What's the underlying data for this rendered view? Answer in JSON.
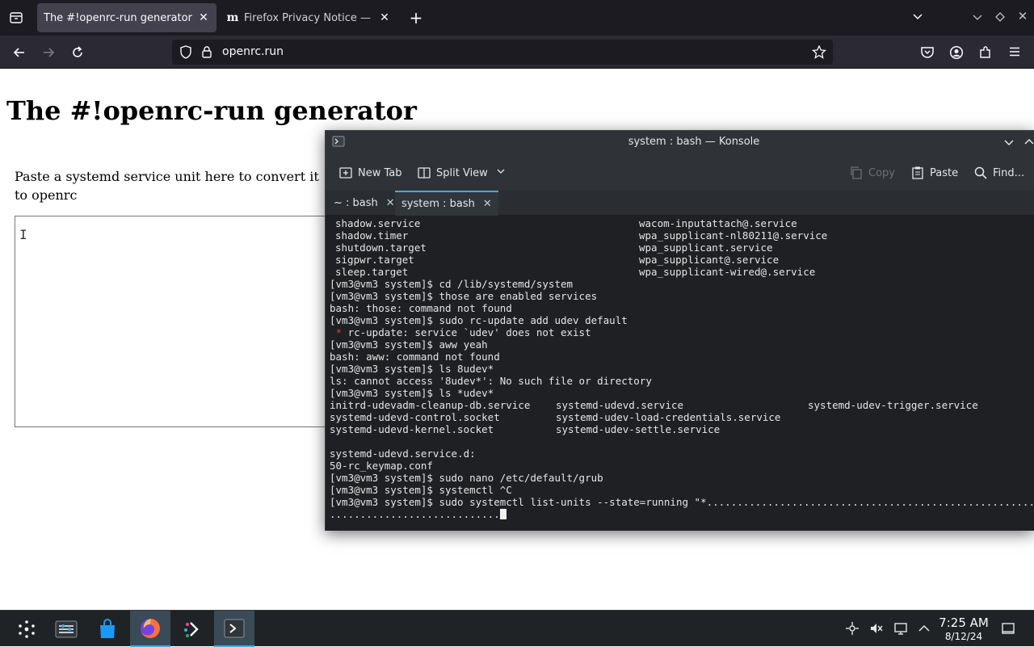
{
  "browser": {
    "tabs": [
      {
        "title": "The #!openrc-run generator",
        "active": true
      },
      {
        "title": "Firefox Privacy Notice — M",
        "favicon_letter": "m",
        "active": false
      }
    ],
    "url": "openrc.run"
  },
  "page": {
    "title": "The #!openrc-run generator",
    "intro": "Paste a systemd service unit here to convert it to openrc",
    "unit_input_value": "",
    "text_cursor": "I"
  },
  "konsole": {
    "window_title": "system : bash — Konsole",
    "toolbar": {
      "new_tab": "New Tab",
      "split_view": "Split View",
      "copy": "Copy",
      "paste": "Paste",
      "find": "Find..."
    },
    "tabs": [
      {
        "label": "~ : bash",
        "active": false
      },
      {
        "label": "system : bash",
        "active": true
      }
    ],
    "listing_top": [
      [
        "shadow.service",
        "wacom-inputattach@.service"
      ],
      [
        "shadow.timer",
        "wpa_supplicant-nl80211@.service"
      ],
      [
        "shutdown.target",
        "wpa_supplicant.service"
      ],
      [
        "sigpwr.target",
        "wpa_supplicant@.service"
      ],
      [
        "sleep.target",
        "wpa_supplicant-wired@.service"
      ]
    ],
    "lines_a": [
      "[vm3@vm3 system]$ cd /lib/systemd/system",
      "[vm3@vm3 system]$ those are enabled services",
      "bash: those: command not found",
      "[vm3@vm3 system]$ sudo rc-update add udev default"
    ],
    "error_mark": " * ",
    "error_text": "rc-update: service `udev' does not exist",
    "lines_b": [
      "[vm3@vm3 system]$ aww yeah",
      "bash: aww: command not found",
      "[vm3@vm3 system]$ ls 8udev*",
      "ls: cannot access '8udev*': No such file or directory",
      "[vm3@vm3 system]$ ls *udev*"
    ],
    "listing_udev": [
      [
        "initrd-udevadm-cleanup-db.service",
        "systemd-udevd.service",
        "systemd-udev-trigger.service"
      ],
      [
        "systemd-udevd-control.socket",
        "systemd-udev-load-credentials.service",
        ""
      ],
      [
        "systemd-udevd-kernel.socket",
        "systemd-udev-settle.service",
        ""
      ]
    ],
    "lines_c": [
      "",
      "systemd-udevd.service.d:",
      "50-rc_keymap.conf",
      "[vm3@vm3 system]$ sudo nano /etc/default/grub",
      "[vm3@vm3 system]$ systemctl ^C",
      "[vm3@vm3 system]$ sudo systemctl list-units --state=running \"*.............................................................",
      "............................"
    ]
  },
  "taskbar": {
    "time": "7:25 AM",
    "date": "8/12/24"
  },
  "colors": {
    "firefox_tabbar": "#1c1b22",
    "firefox_toolbar": "#2b2a33",
    "konsole_bg": "#1e2023",
    "konsole_error": "#d1473a",
    "kde_accent": "#3daee9",
    "panel_bg": "#202326"
  }
}
